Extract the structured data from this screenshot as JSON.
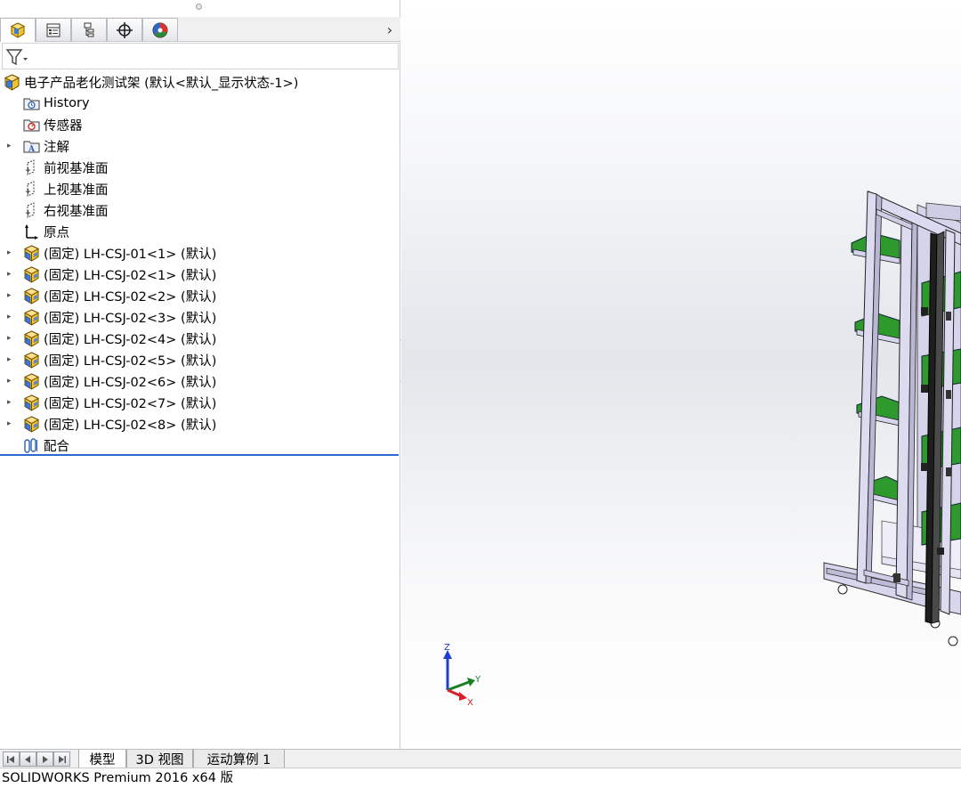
{
  "feature_tree": {
    "root": "电子产品老化测试架  (默认<默认_显示状态-1>)",
    "nodes": [
      {
        "label": "History",
        "icon": "history-folder-icon",
        "expandable": false
      },
      {
        "label": "传感器",
        "icon": "sensors-folder-icon",
        "expandable": false
      },
      {
        "label": "注解",
        "icon": "annotations-folder-icon",
        "expandable": true
      },
      {
        "label": "前视基准面",
        "icon": "plane-icon",
        "expandable": false
      },
      {
        "label": "上视基准面",
        "icon": "plane-icon",
        "expandable": false
      },
      {
        "label": "右视基准面",
        "icon": "plane-icon",
        "expandable": false
      },
      {
        "label": "原点",
        "icon": "origin-icon",
        "expandable": false
      },
      {
        "label": "(固定) LH-CSJ-01<1> (默认)",
        "icon": "part-icon",
        "expandable": true
      },
      {
        "label": "(固定) LH-CSJ-02<1> (默认)",
        "icon": "part-icon",
        "expandable": true
      },
      {
        "label": "(固定) LH-CSJ-02<2> (默认)",
        "icon": "part-icon",
        "expandable": true
      },
      {
        "label": "(固定) LH-CSJ-02<3> (默认)",
        "icon": "part-icon",
        "expandable": true
      },
      {
        "label": "(固定) LH-CSJ-02<4> (默认)",
        "icon": "part-icon",
        "expandable": true
      },
      {
        "label": "(固定) LH-CSJ-02<5> (默认)",
        "icon": "part-icon",
        "expandable": true
      },
      {
        "label": "(固定) LH-CSJ-02<6> (默认)",
        "icon": "part-icon",
        "expandable": true
      },
      {
        "label": "(固定) LH-CSJ-02<7> (默认)",
        "icon": "part-icon",
        "expandable": true
      },
      {
        "label": "(固定) LH-CSJ-02<8> (默认)",
        "icon": "part-icon",
        "expandable": true
      },
      {
        "label": "配合",
        "icon": "mates-icon",
        "expandable": false
      }
    ]
  },
  "panel_tabs": [
    {
      "icon": "feature-manager-icon",
      "active": true
    },
    {
      "icon": "property-manager-icon",
      "active": false
    },
    {
      "icon": "configuration-manager-icon",
      "active": false
    },
    {
      "icon": "dimxpert-icon",
      "active": false
    },
    {
      "icon": "display-manager-icon",
      "active": false
    }
  ],
  "triad": {
    "x": "X",
    "y": "Y",
    "z": "Z"
  },
  "bottom_tabs": [
    {
      "label": "模型",
      "active": true
    },
    {
      "label": "3D 视图",
      "active": false
    },
    {
      "label": "运动算例 1",
      "active": false
    }
  ],
  "status_text": "SOLIDWORKS Premium 2016 x64 版",
  "colors": {
    "accent_blue": "#2b6ad0",
    "pcb_green": "#2e9a2e",
    "frame_lavender": "#d6d4ec"
  }
}
